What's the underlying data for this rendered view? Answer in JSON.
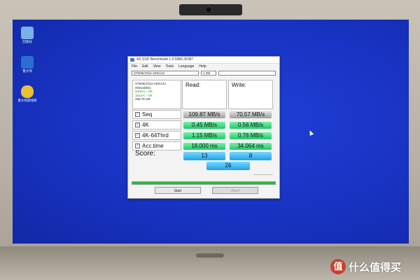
{
  "desktop": {
    "icons": [
      {
        "label": "回收站",
        "icon": "recycle-bin-icon",
        "color": "#7ab0e8"
      },
      {
        "label": "鲁大师",
        "icon": "ludashi-icon",
        "color": "#2a6fd0"
      },
      {
        "label": "鲁大师游戏库",
        "icon": "game-controller-icon",
        "color": "#e8c03a"
      }
    ]
  },
  "window": {
    "title": "AS SSD Benchmark 1.9.5986.35387",
    "menu": [
      "File",
      "Edit",
      "View",
      "Tools",
      "Language",
      "Help"
    ],
    "drive_select": "ST500LT012-1DG142",
    "size_select": "1 GB",
    "drive_info": {
      "model": "ST500LT012-1DG142",
      "firmware": "0001SDM1",
      "driver": "iaStorA - OK",
      "align": "1024 K - OK",
      "capacity": "465.76 GB"
    },
    "headers": {
      "read": "Read:",
      "write": "Write:"
    },
    "rows": [
      {
        "label": "Seq",
        "read": "109.87 MB/s",
        "write": "70.57 MB/s",
        "style": "gray"
      },
      {
        "label": "4K",
        "read": "0.45 MB/s",
        "write": "0.56 MB/s",
        "style": "green"
      },
      {
        "label": "4K-64Thrd",
        "read": "1.15 MB/s",
        "write": "0.76 MB/s",
        "style": "green"
      },
      {
        "label": "Acc.time",
        "read": "18.000 ms",
        "write": "34.064 ms",
        "style": "green"
      }
    ],
    "score": {
      "label": "Score:",
      "read": "13",
      "write": "8",
      "total": "26"
    },
    "progress": 1.0,
    "buttons": {
      "start": "Start",
      "abort": "Abort"
    }
  },
  "watermark": {
    "text": "什么值得买",
    "icon": "smzdm-logo-icon"
  }
}
